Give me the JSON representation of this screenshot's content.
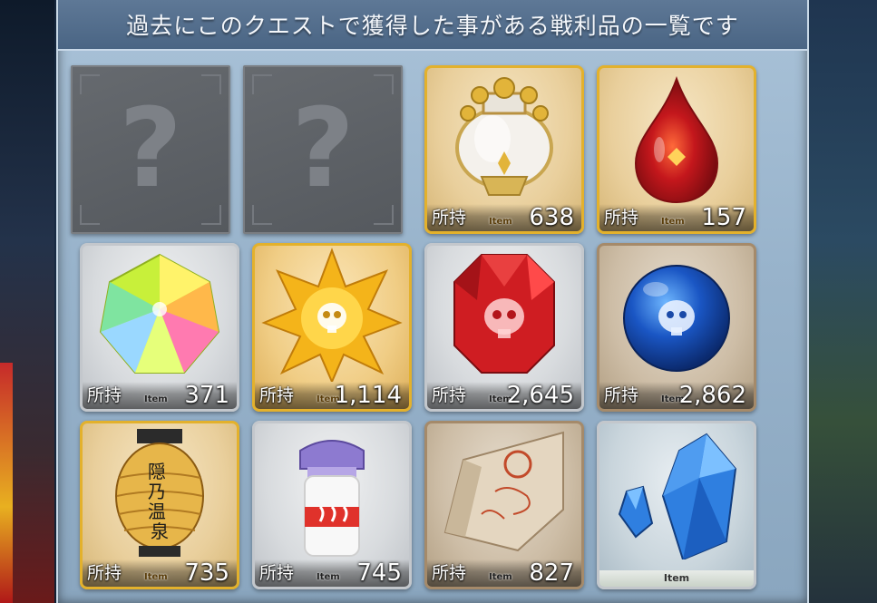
{
  "panel": {
    "title": "過去にこのクエストで獲得した事がある戦利品の一覧です"
  },
  "items": [
    {
      "unknown": true,
      "mark": "?"
    },
    {
      "unknown": true,
      "mark": "?"
    },
    {
      "icon": "white-vase-icon",
      "frame": "gold",
      "owned_label": "所持",
      "tag": "Item",
      "qty": "638"
    },
    {
      "icon": "red-drop-icon",
      "frame": "gold",
      "owned_label": "所持",
      "tag": "Item",
      "qty": "157"
    },
    {
      "icon": "rainbow-gem-icon",
      "frame": "silver",
      "owned_label": "所持",
      "tag": "Item",
      "qty": "371"
    },
    {
      "icon": "gold-skull-star-icon",
      "frame": "gold",
      "owned_label": "所持",
      "tag": "Item",
      "qty": "1,114"
    },
    {
      "icon": "red-skull-gem-icon",
      "frame": "silver",
      "owned_label": "所持",
      "tag": "Item",
      "qty": "2,645"
    },
    {
      "icon": "blue-skull-orb-icon",
      "frame": "bronze",
      "owned_label": "所持",
      "tag": "Item",
      "qty": "2,862"
    },
    {
      "icon": "paper-lantern-icon",
      "frame": "gold",
      "owned_label": "所持",
      "tag": "Item",
      "qty": "735",
      "lantern_text": "隠乃温泉"
    },
    {
      "icon": "milk-bottle-icon",
      "frame": "silver",
      "owned_label": "所持",
      "tag": "Item",
      "qty": "745"
    },
    {
      "icon": "scroll-cloth-icon",
      "frame": "bronze",
      "owned_label": "所持",
      "tag": "Item",
      "qty": "827"
    },
    {
      "icon": "blue-crystal-icon",
      "frame": "crystal",
      "tag": "Item"
    }
  ],
  "colors": {
    "gold_frame": "#e3b12c",
    "silver_frame": "#c3c7cc",
    "bronze_frame": "#a58a6a",
    "header": "#4a6584",
    "panel": "#98b3cb"
  }
}
